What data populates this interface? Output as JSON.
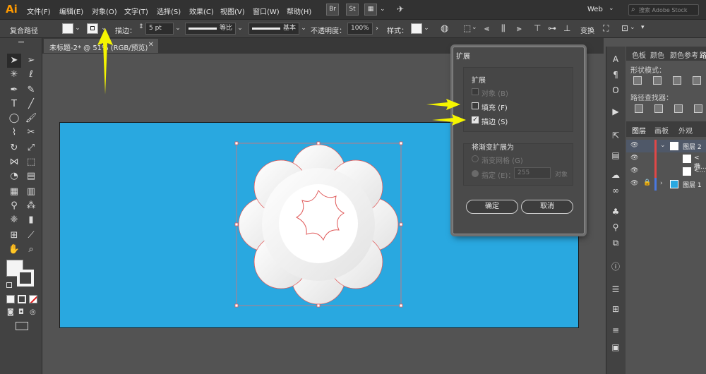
{
  "app": {
    "logo": "Ai"
  },
  "menu": [
    "文件(F)",
    "编辑(E)",
    "对象(O)",
    "文字(T)",
    "选择(S)",
    "效果(C)",
    "视图(V)",
    "窗口(W)",
    "帮助(H)"
  ],
  "menubar_right": {
    "workspace": "Web",
    "stock_search_placeholder": "搜索 Adobe Stock",
    "br": "Br",
    "st": "St"
  },
  "controlbar": {
    "selection_type": "复合路径",
    "stroke_label": "描边：",
    "stroke_value": "5 pt",
    "stroke_profile": "等比",
    "brush": "基本",
    "opacity_label": "不透明度：",
    "opacity_value": "100%",
    "style_label": "样式：",
    "transform_label": "变换"
  },
  "document": {
    "tab_title": "未标题-2* @ 51% (RGB/预览)"
  },
  "colors": {
    "artboard": "#29a8e0",
    "accent_arrow": "#f5f500"
  },
  "dialog": {
    "title": "扩展",
    "expand_group_label": "扩展",
    "options": [
      {
        "label": "对象 (B)",
        "checked": false,
        "disabled": true
      },
      {
        "label": "填充 (F)",
        "checked": false,
        "disabled": false
      },
      {
        "label": "描边 (S)",
        "checked": true,
        "disabled": false
      }
    ],
    "gradient_group_label": "将渐变扩展为",
    "gradient_mesh": "渐变网格 (G)",
    "specify": "指定 (E)：",
    "specify_value": "255",
    "specify_unit": "对象",
    "ok": "确定",
    "cancel": "取消"
  },
  "right_panel": {
    "top_tabs": [
      "色板",
      "颜色",
      "颜色参考",
      "路"
    ],
    "shape_modes_label": "形状模式：",
    "pathfinder_label": "路径查找器：",
    "layer_tabs": [
      "图层",
      "画板",
      "外观"
    ],
    "layers": [
      {
        "name": "图层 2"
      },
      {
        "name": "<椭..."
      },
      {
        "name": "<..."
      },
      {
        "name": "图层 1"
      }
    ]
  }
}
